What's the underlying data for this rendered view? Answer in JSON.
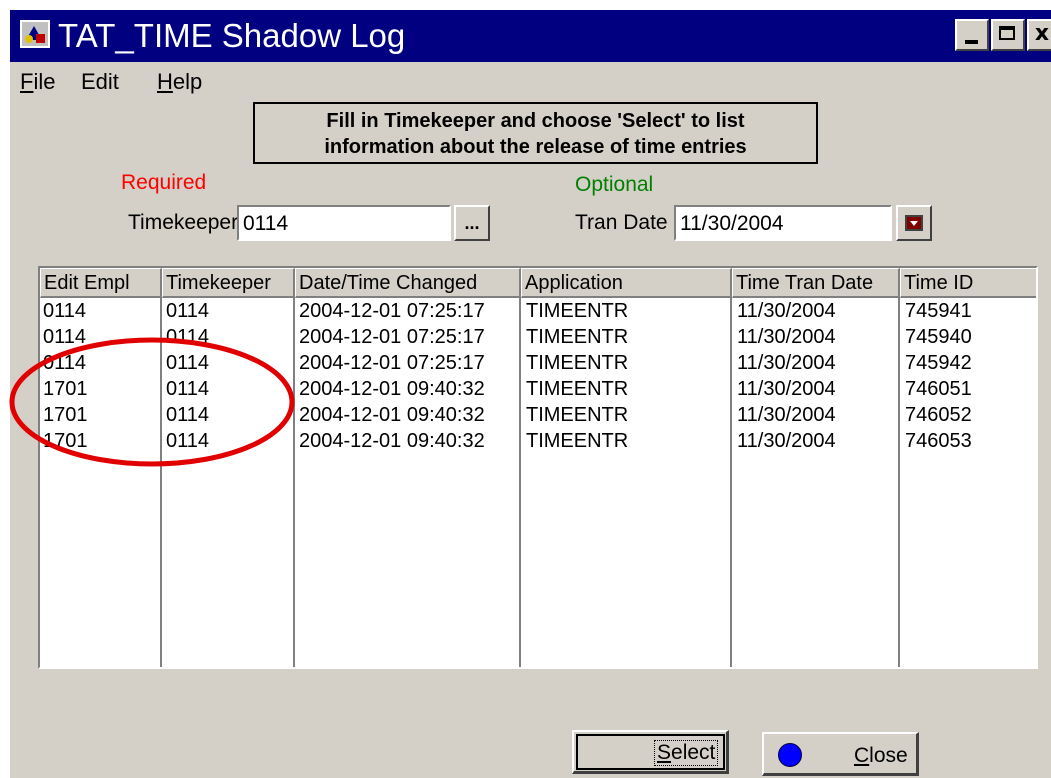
{
  "window": {
    "title": "TAT_TIME Shadow Log",
    "controls": {
      "minimize": "_",
      "maximize": "□",
      "close": "x"
    }
  },
  "menu": {
    "items": [
      {
        "label": "File",
        "accel": "F",
        "rest": "ile"
      },
      {
        "label": "Edit",
        "accel": "",
        "rest": "Edit"
      },
      {
        "label": "Help",
        "accel": "H",
        "rest": "elp"
      }
    ]
  },
  "instructions": {
    "line1": "Fill in Timekeeper and choose 'Select' to list",
    "line2": "information about the release of time entries"
  },
  "form": {
    "required_label": "Required",
    "optional_label": "Optional",
    "timekeeper_label": "Timekeeper",
    "timekeeper_value": "0114",
    "lookup_button": "...",
    "tran_date_label": "Tran Date",
    "tran_date_value": "11/30/2004"
  },
  "grid": {
    "columns": [
      "Edit Empl",
      "Timekeeper",
      "Date/Time Changed",
      "Application",
      "Time Tran Date",
      "Time ID"
    ],
    "rows": [
      [
        "0114",
        "0114",
        "2004-12-01 07:25:17",
        "TIMEENTR",
        "11/30/2004",
        "745941"
      ],
      [
        "0114",
        "0114",
        "2004-12-01 07:25:17",
        "TIMEENTR",
        "11/30/2004",
        "745940"
      ],
      [
        "0114",
        "0114",
        "2004-12-01 07:25:17",
        "TIMEENTR",
        "11/30/2004",
        "745942"
      ],
      [
        "1701",
        "0114",
        "2004-12-01 09:40:32",
        "TIMEENTR",
        "11/30/2004",
        "746051"
      ],
      [
        "1701",
        "0114",
        "2004-12-01 09:40:32",
        "TIMEENTR",
        "11/30/2004",
        "746052"
      ],
      [
        "1701",
        "0114",
        "2004-12-01 09:40:32",
        "TIMEENTR",
        "11/30/2004",
        "746053"
      ]
    ]
  },
  "buttons": {
    "select": {
      "accel": "S",
      "rest": "elect"
    },
    "close": {
      "accel": "C",
      "rest": "lose"
    }
  },
  "colors": {
    "title_bar": "#000080",
    "required": "#ff0000",
    "optional": "#008000",
    "annotation": "#e00000"
  }
}
